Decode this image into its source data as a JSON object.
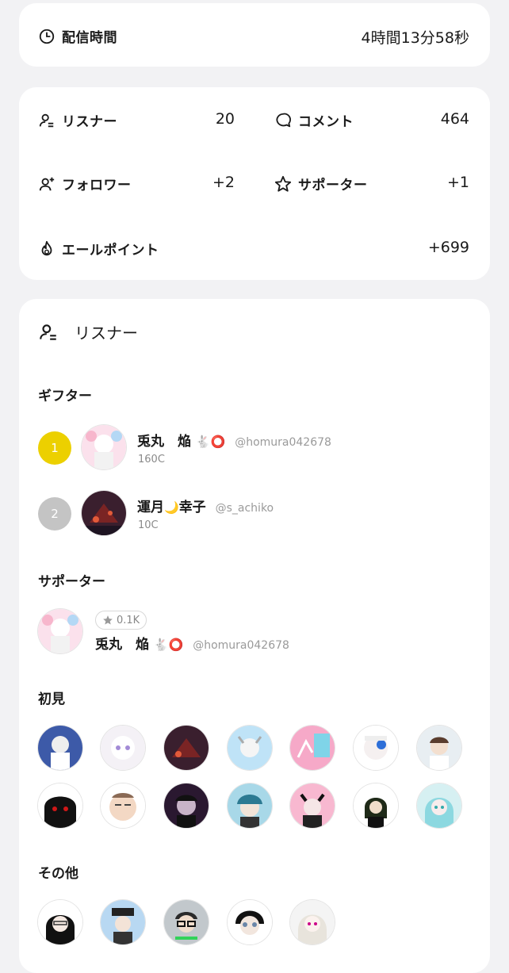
{
  "duration": {
    "label": "配信時間",
    "value": "4時間13分58秒"
  },
  "stats": {
    "listeners": {
      "label": "リスナー",
      "value": "20"
    },
    "comments": {
      "label": "コメント",
      "value": "464"
    },
    "followers": {
      "label": "フォロワー",
      "value": "+2"
    },
    "supporters": {
      "label": "サポーター",
      "value": "+1"
    },
    "yell_points": {
      "label": "エールポイント",
      "value": "+699"
    }
  },
  "listeners_section": {
    "title": "リスナー",
    "gifters_title": "ギフター",
    "gifters": [
      {
        "rank": "1",
        "name": "兎丸　焔",
        "emoji": "🐇⭕",
        "handle": "@homura042678",
        "amount": "160C",
        "rank_color": "#ecd000"
      },
      {
        "rank": "2",
        "name": "運月",
        "name2": "幸子",
        "emoji": "🌙",
        "handle": "@s_achiko",
        "amount": "10C",
        "rank_color": "#c4c4c4"
      }
    ],
    "supporters_title": "サポーター",
    "supporter": {
      "badge": "0.1K",
      "name": "兎丸　焔",
      "emoji": "🐇⭕",
      "handle": "@homura042678"
    },
    "first_time_title": "初見",
    "others_title": "その他"
  },
  "colors": {
    "background": "#f2f2f4",
    "card": "#ffffff",
    "rank1": "#ecd000",
    "rank2": "#c4c4c4"
  }
}
